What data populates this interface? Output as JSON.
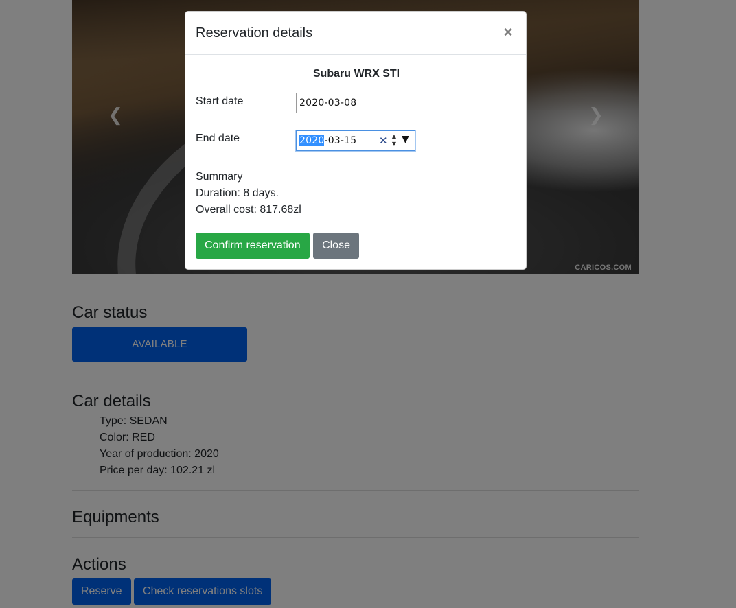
{
  "carousel": {
    "watermark": "CARICOS.COM",
    "prev_icon": "chevron-left-icon",
    "next_icon": "chevron-right-icon"
  },
  "car_status": {
    "heading": "Car status",
    "status_label": "AVAILABLE"
  },
  "car_details": {
    "heading": "Car details",
    "items": [
      "Type: SEDAN",
      "Color: RED",
      "Year of production: 2020",
      "Price per day: 102.21 zl"
    ]
  },
  "equipments": {
    "heading": "Equipments"
  },
  "actions": {
    "heading": "Actions",
    "reserve_label": "Reserve",
    "check_label": "Check reservations slots"
  },
  "modal": {
    "title": "Reservation details",
    "close_glyph": "×",
    "car_name": "Subaru WRX STI",
    "start_label": "Start date",
    "start_value": "2020-03-08",
    "end_label": "End date",
    "end_value_selected": "2020",
    "end_value_rest": "-03-15",
    "summary_title": "Summary",
    "duration": "Duration: 8 days.",
    "overall_cost": "Overall cost: 817.68zl",
    "confirm_label": "Confirm reservation",
    "close_label": "Close"
  },
  "colors": {
    "primary": "#0062f0",
    "success": "#28a745",
    "secondary": "#6c757d"
  }
}
